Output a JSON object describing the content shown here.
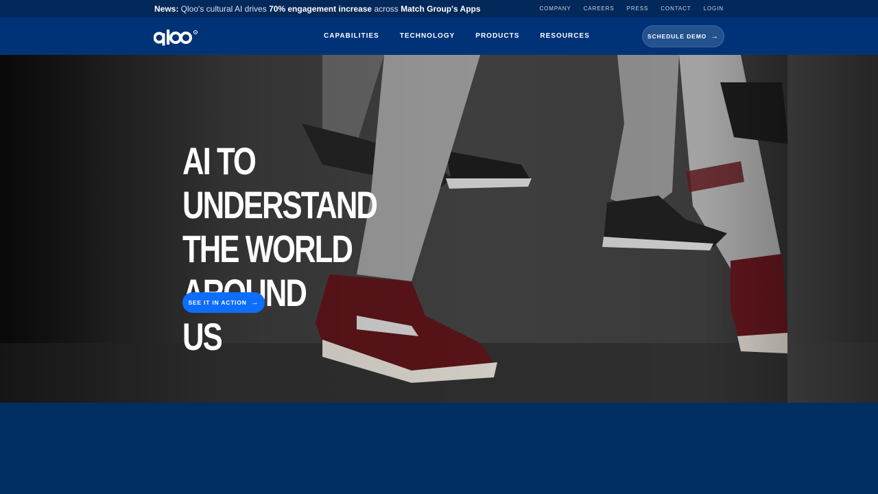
{
  "news": {
    "prefix": "News:",
    "part1": " Qloo's cultural AI drives ",
    "highlight1": "70% engagement increase",
    "part2": " across ",
    "highlight2": "Match Group's Apps"
  },
  "top_links": [
    "COMPANY",
    "CAREERS",
    "PRESS",
    "CONTACT",
    "LOGIN"
  ],
  "logo": {
    "text": "qloo"
  },
  "nav": {
    "items": [
      "CAPABILITIES",
      "TECHNOLOGY",
      "PRODUCTS",
      "RESOURCES"
    ],
    "demo_label": "SCHEDULE DEMO"
  },
  "hero": {
    "headline_line1": "AI TO UNDERSTAND",
    "headline_line2": "THE WORLD AROUND",
    "headline_line3": "US",
    "cta_label": "SEE IT IN ACTION"
  },
  "colors": {
    "topbar": "#03285a",
    "nav": "#003278",
    "cta": "#0d6efd",
    "footer": "#002d62"
  }
}
